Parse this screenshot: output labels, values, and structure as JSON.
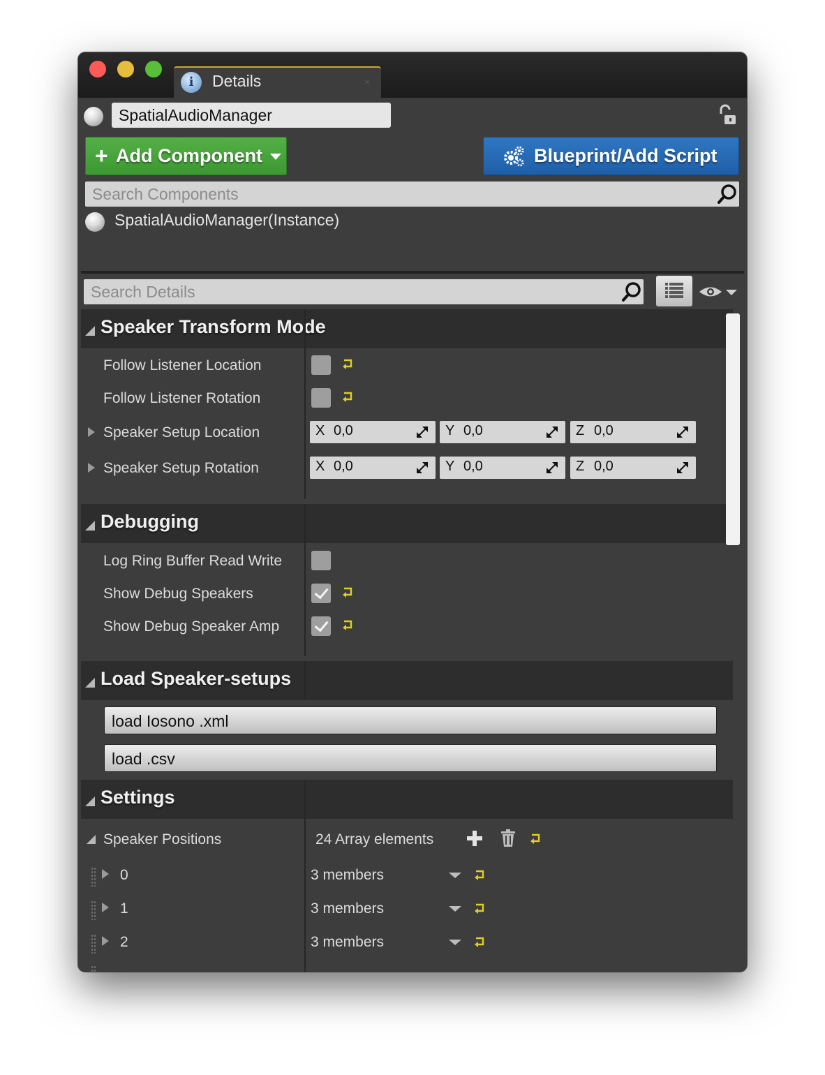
{
  "window": {
    "tab_label": "Details",
    "tab_close": "×"
  },
  "actor": {
    "name_value": "SpatialAudioManager",
    "instance_label": "SpatialAudioManager(Instance)"
  },
  "toolbar": {
    "add_component_label": "Add Component",
    "add_component_plus": "+",
    "blueprint_label": "Blueprint/Add Script"
  },
  "search": {
    "components_placeholder": "Search Components",
    "details_placeholder": "Search Details"
  },
  "categories": {
    "speaker_transform": {
      "title": "Speaker Transform Mode",
      "rows": [
        {
          "label": "Follow Listener Location",
          "checked": false
        },
        {
          "label": "Follow Listener Rotation",
          "checked": false
        }
      ],
      "vectors": [
        {
          "label": "Speaker Setup Location",
          "x": "0,0",
          "y": "0,0",
          "z": "0,0"
        },
        {
          "label": "Speaker Setup Rotation",
          "x": "0,0",
          "y": "0,0",
          "z": "0,0"
        }
      ]
    },
    "debugging": {
      "title": "Debugging",
      "rows": [
        {
          "label": "Log Ring Buffer Read Write",
          "checked": false
        },
        {
          "label": "Show Debug Speakers",
          "checked": true
        },
        {
          "label": "Show Debug Speaker Amp",
          "checked": true
        }
      ]
    },
    "load": {
      "title": "Load Speaker-setups",
      "buttons": [
        "load Iosono .xml",
        "load .csv"
      ]
    },
    "settings": {
      "title": "Settings",
      "array_label": "Speaker Positions",
      "array_count": "24 Array elements",
      "elements": [
        {
          "index": "0",
          "value": "3 members"
        },
        {
          "index": "1",
          "value": "3 members"
        },
        {
          "index": "2",
          "value": "3 members"
        }
      ]
    }
  },
  "axes": {
    "x": "X",
    "y": "Y",
    "z": "Z"
  },
  "colors": {
    "add_component": "#4aa53d",
    "blueprint": "#2a6db8",
    "reset_arrow": "#e0d020",
    "tab_accent": "#c9a83a"
  },
  "icons": {
    "lock": "unlocked-padlock-icon",
    "search": "magnifier-icon",
    "gear": "gears-icon",
    "view": "list-view-icon",
    "eye": "eye-icon",
    "reset": "reset-to-default-icon",
    "add": "plus-icon",
    "trash": "trash-icon"
  }
}
